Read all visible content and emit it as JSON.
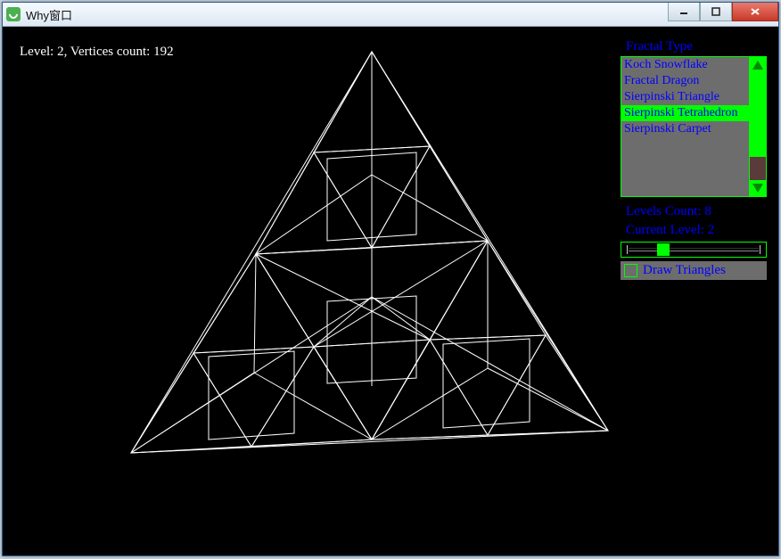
{
  "window": {
    "title": "Why窗口"
  },
  "status": {
    "text": "Level: 2, Vertices count: 192"
  },
  "panel": {
    "fractal_type_label": "Fractal Type",
    "items": [
      "Koch Snowflake",
      "Fractal Dragon",
      "Sierpinski Triangle",
      "Sierpinski Tetrahedron",
      "Sierpinski Carpet"
    ],
    "selected_index": 3,
    "levels_count_label": "Levels Count: 8",
    "current_level_label": "Current Level: 2",
    "slider": {
      "min": 0,
      "max": 8,
      "value": 2
    },
    "draw_triangles_label": "Draw Triangles",
    "draw_triangles_checked": false
  },
  "chart_data": {
    "type": "wireframe-3d",
    "shape": "Sierpinski Tetrahedron",
    "level": 2,
    "vertices": 192,
    "color": "#ffffff",
    "background": "#000000"
  }
}
